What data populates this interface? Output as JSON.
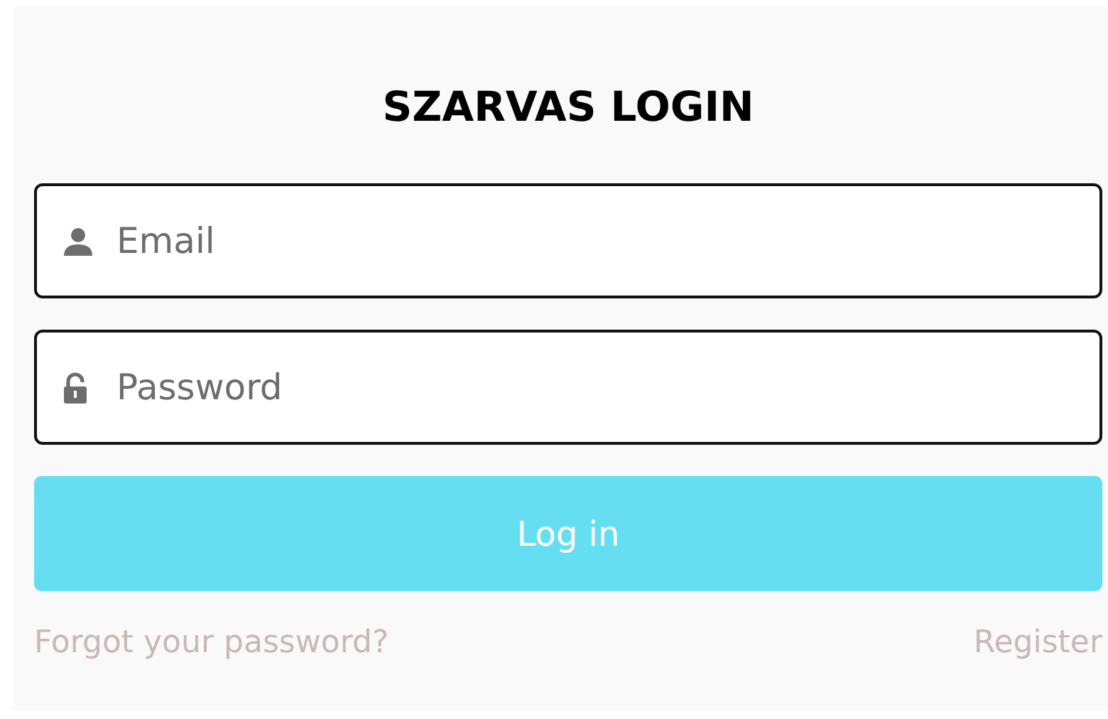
{
  "title": "SZARVAS LOGIN",
  "fields": [
    {
      "kind": "email",
      "placeholder": "Email"
    },
    {
      "kind": "password",
      "placeholder": "Password"
    }
  ],
  "submit_button": "Log in",
  "links": [
    {
      "label": "Forgot your password?"
    },
    {
      "label": "Register"
    }
  ]
}
